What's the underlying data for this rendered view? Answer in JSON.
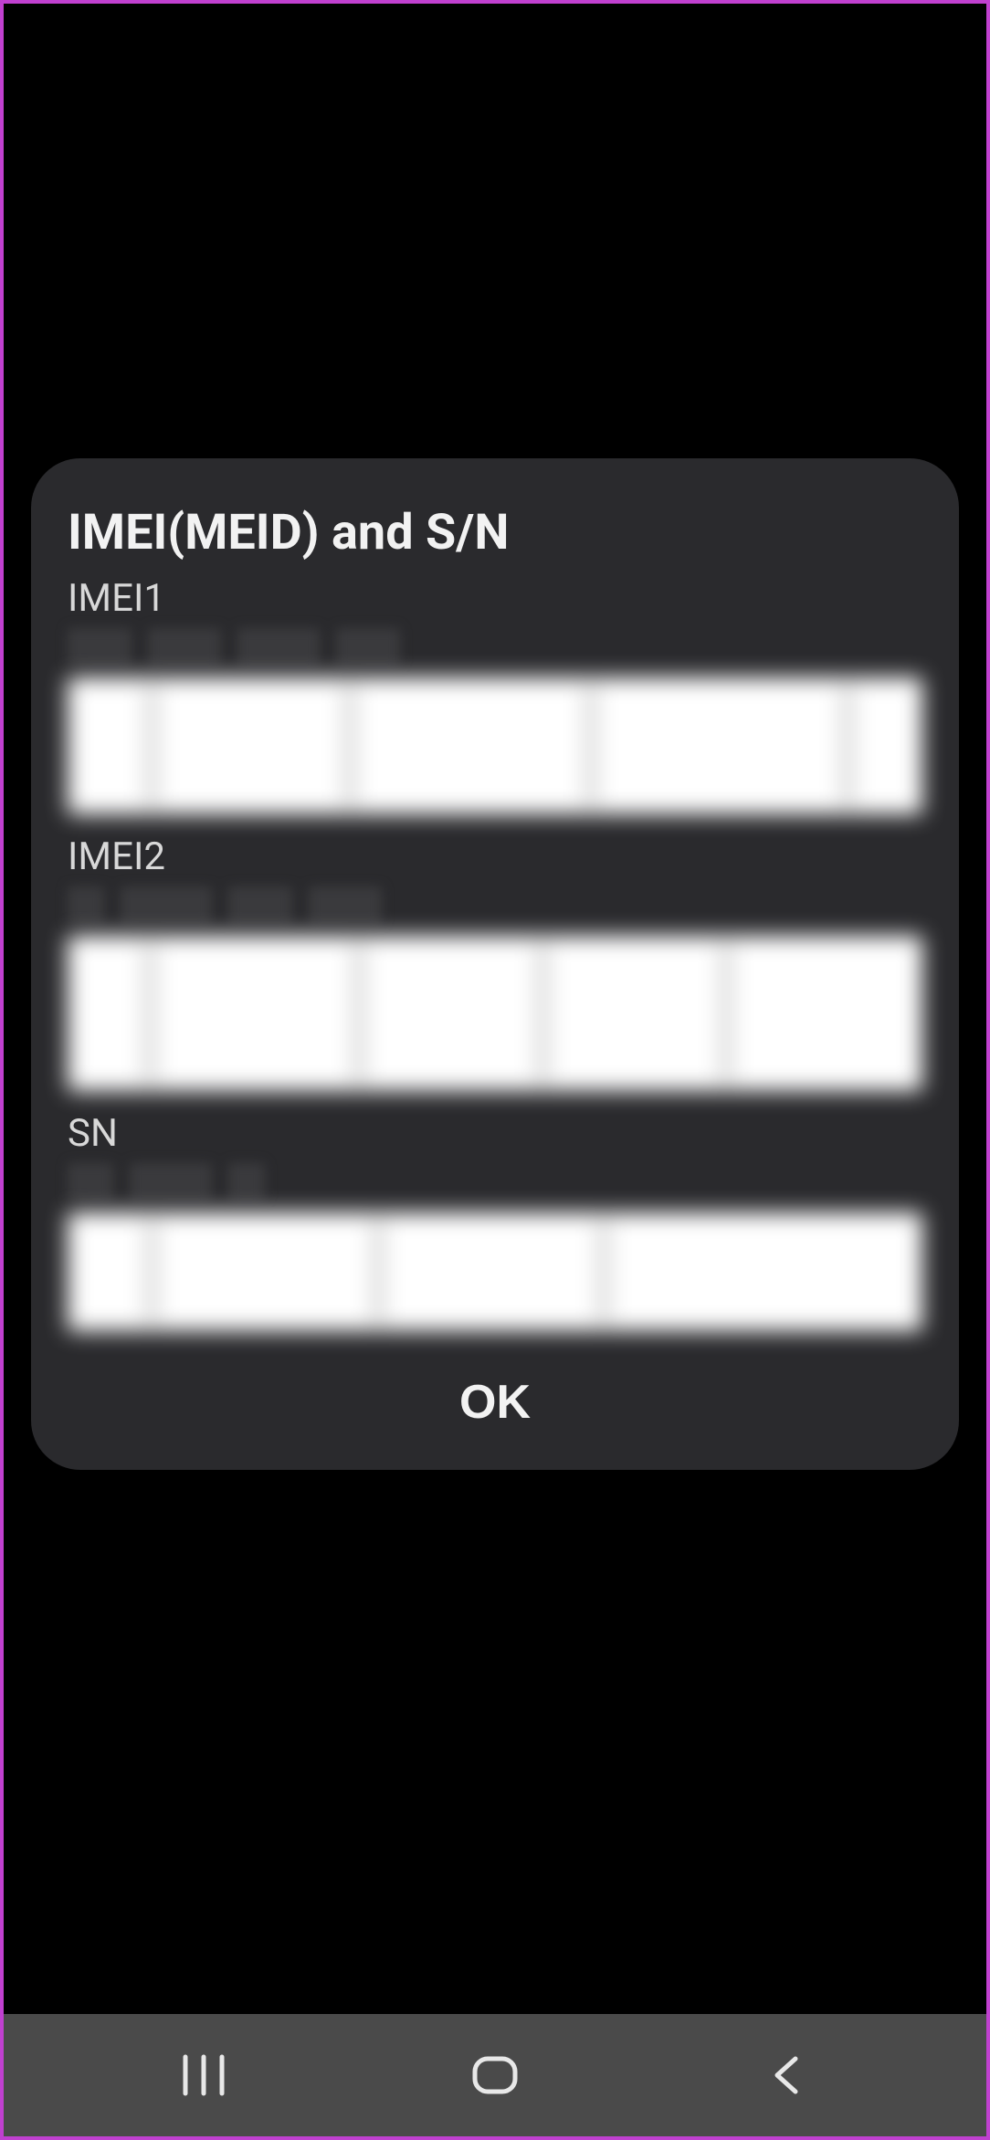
{
  "dialog": {
    "title": "IMEI(MEID) and S/N",
    "ok_label": "OK",
    "sections": [
      {
        "label": "IMEI1"
      },
      {
        "label": "IMEI2"
      },
      {
        "label": "SN"
      }
    ]
  },
  "nav": {
    "recents": "recents-icon",
    "home": "home-icon",
    "back": "back-icon"
  }
}
